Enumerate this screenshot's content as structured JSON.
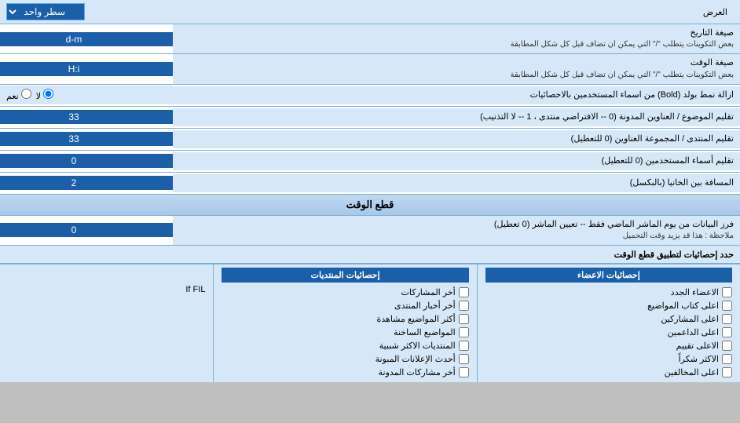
{
  "header": {
    "title": "العرض",
    "select_label": "سطر واحد"
  },
  "rows": [
    {
      "id": "date_format",
      "label": "صيغة التاريخ\nبعض التكوينات يتطلب \"/\" التي يمكن ان تضاف قبل كل شكل المطابقة",
      "label_line1": "صيغة التاريخ",
      "label_line2": "بعض التكوينات يتطلب \"/\" التي يمكن ان تضاف قبل كل شكل المطابقة",
      "value": "d-m"
    },
    {
      "id": "time_format",
      "label_line1": "صيغة الوقت",
      "label_line2": "بعض التكوينات يتطلب \"/\" التي يمكن ان تضاف قبل كل شكل المطابقة",
      "value": "H:i"
    },
    {
      "id": "bold_remove",
      "label_line1": "ازالة نمط بولد (Bold) من اسماء المستخدمين بالاحصائيات",
      "label_line2": "",
      "type": "radio",
      "options": [
        "نعم",
        "لا"
      ],
      "selected": "لا"
    },
    {
      "id": "subject_headers",
      "label_line1": "تقليم الموضوع / العناوين المدونة (0 -- الافتراضي منتدى ، 1 -- لا التذنيب)",
      "label_line2": "",
      "value": "33"
    },
    {
      "id": "forum_headers",
      "label_line1": "تقليم المنتدى / المجموعة العناوين (0 للتعطيل)",
      "label_line2": "",
      "value": "33"
    },
    {
      "id": "usernames",
      "label_line1": "تقليم أسماء المستخدمين (0 للتعطيل)",
      "label_line2": "",
      "value": "0"
    },
    {
      "id": "column_gap",
      "label_line1": "المسافة بين الخانيا (بالبكسل)",
      "label_line2": "",
      "value": "2"
    }
  ],
  "section": {
    "title": "قطع الوقت"
  },
  "cutoff_row": {
    "label_line1": "فرز البيانات من يوم الماشر الماضي فقط -- تعيين الماشر (0 تعطيل)",
    "label_line2": "ملاحظة : هذا قد يزيد وقت التحميل",
    "value": "0"
  },
  "stats_label": "حدد إحصائيات لتطبيق قطع الوقت",
  "col_posts": {
    "header": "إحصائيات المنتديات",
    "items": [
      "أخر المشاركات",
      "أخر أخبار المنتدى",
      "أكثر المواضيع مشاهدة",
      "المواضيع الساخنة",
      "المنتديات الاكثر شببية",
      "أحدث الإعلانات المبونة",
      "أخر مشاركات المدونة"
    ]
  },
  "col_members": {
    "header": "إحصائيات الاعضاء",
    "items": [
      "الاعضاء الجدد",
      "اعلى كتاب المواضيع",
      "اعلى المشاركين",
      "اعلى الداعمين",
      "الاعلى تقييم",
      "الاكثر شكراً",
      "اعلى المخالفين"
    ]
  }
}
